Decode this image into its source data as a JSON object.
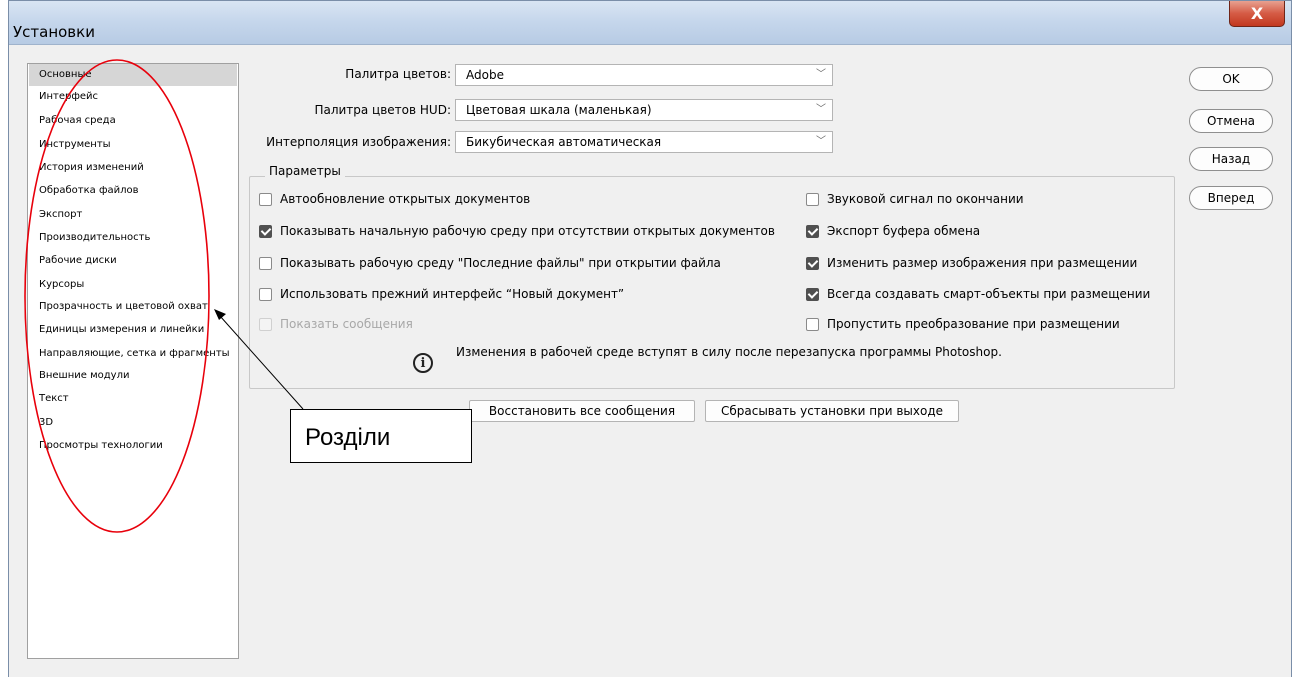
{
  "window": {
    "title": "Установки",
    "close_label": "X"
  },
  "sidebar": {
    "items": [
      {
        "label": "Основные",
        "selected": true
      },
      {
        "label": "Интерфейс"
      },
      {
        "label": "Рабочая среда"
      },
      {
        "label": "Инструменты"
      },
      {
        "label": "История изменений"
      },
      {
        "label": "Обработка файлов"
      },
      {
        "label": "Экспорт"
      },
      {
        "label": "Производительность"
      },
      {
        "label": "Рабочие диски"
      },
      {
        "label": "Курсоры"
      },
      {
        "label": "Прозрачность и цветовой охват"
      },
      {
        "label": "Единицы измерения и линейки"
      },
      {
        "label": "Направляющие, сетка и фрагменты"
      },
      {
        "label": "Внешние модули"
      },
      {
        "label": "Текст"
      },
      {
        "label": "3D"
      },
      {
        "label": "Просмотры технологии"
      }
    ]
  },
  "fields": {
    "color_picker": {
      "label": "Палитра цветов:",
      "value": "Adobe"
    },
    "hud_picker": {
      "label": "Палитра цветов HUD:",
      "value": "Цветовая шкала (маленькая)"
    },
    "interpolation": {
      "label": "Интерполяция изображения:",
      "value": "Бикубическая автоматическая"
    }
  },
  "options": {
    "legend": "Параметры",
    "left": [
      {
        "label": "Автообновление открытых документов",
        "checked": false
      },
      {
        "label": "Показывать начальную рабочую среду при отсутствии открытых документов",
        "checked": true
      },
      {
        "label": "Показывать рабочую среду \"Последние файлы\" при открытии файла",
        "checked": false
      },
      {
        "label": "Использовать прежний интерфейс “Новый документ”",
        "checked": false
      },
      {
        "label": "Показать сообщения",
        "checked": false,
        "disabled": true
      }
    ],
    "right": [
      {
        "label": "Звуковой сигнал по окончании",
        "checked": false
      },
      {
        "label": "Экспорт буфера обмена",
        "checked": true
      },
      {
        "label": "Изменить размер изображения при размещении",
        "checked": true
      },
      {
        "label": "Всегда создавать смарт-объекты при размещении",
        "checked": true
      },
      {
        "label": "Пропустить преобразование при размещении",
        "checked": false
      }
    ],
    "info_text": "Изменения в рабочей среде вступят в силу после перезапуска программы Photoshop."
  },
  "bottom_buttons": {
    "reset_messages": "Восстановить все сообщения",
    "reset_prefs": "Сбрасывать установки при выходе"
  },
  "side_buttons": {
    "ok": "OK",
    "cancel": "Отмена",
    "back": "Назад",
    "forward": "Вперед"
  },
  "annotation": {
    "label": "Розділи",
    "color": "#e8000b"
  }
}
